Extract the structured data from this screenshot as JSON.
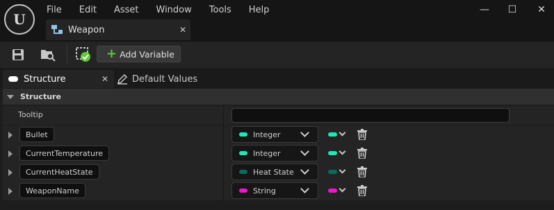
{
  "app": {
    "logo_text": "U"
  },
  "menu": [
    "File",
    "Edit",
    "Asset",
    "Window",
    "Tools",
    "Help"
  ],
  "window_controls": {
    "minimize": "—",
    "maximize": "☐",
    "close": "✕"
  },
  "asset_tab": {
    "label": "Weapon",
    "close": "✕"
  },
  "toolbar": {
    "add_variable_label": "Add Variable",
    "add_icon": "+"
  },
  "panel_tabs": {
    "structure": {
      "label": "Structure",
      "close": "✕"
    },
    "default_values": {
      "label": "Default Values"
    }
  },
  "structure": {
    "section_title": "Structure",
    "tooltip": {
      "label": "Tooltip",
      "value": ""
    },
    "variables": [
      {
        "name": "Bullet",
        "type": "Integer",
        "type_color": "#1de9b6"
      },
      {
        "name": "CurrentTemperature",
        "type": "Integer",
        "type_color": "#1de9b6"
      },
      {
        "name": "CurrentHeatState",
        "type": "Heat State",
        "type_color": "#0b6b5e"
      },
      {
        "name": "WeaponName",
        "type": "String",
        "type_color": "#f015d0"
      }
    ]
  }
}
